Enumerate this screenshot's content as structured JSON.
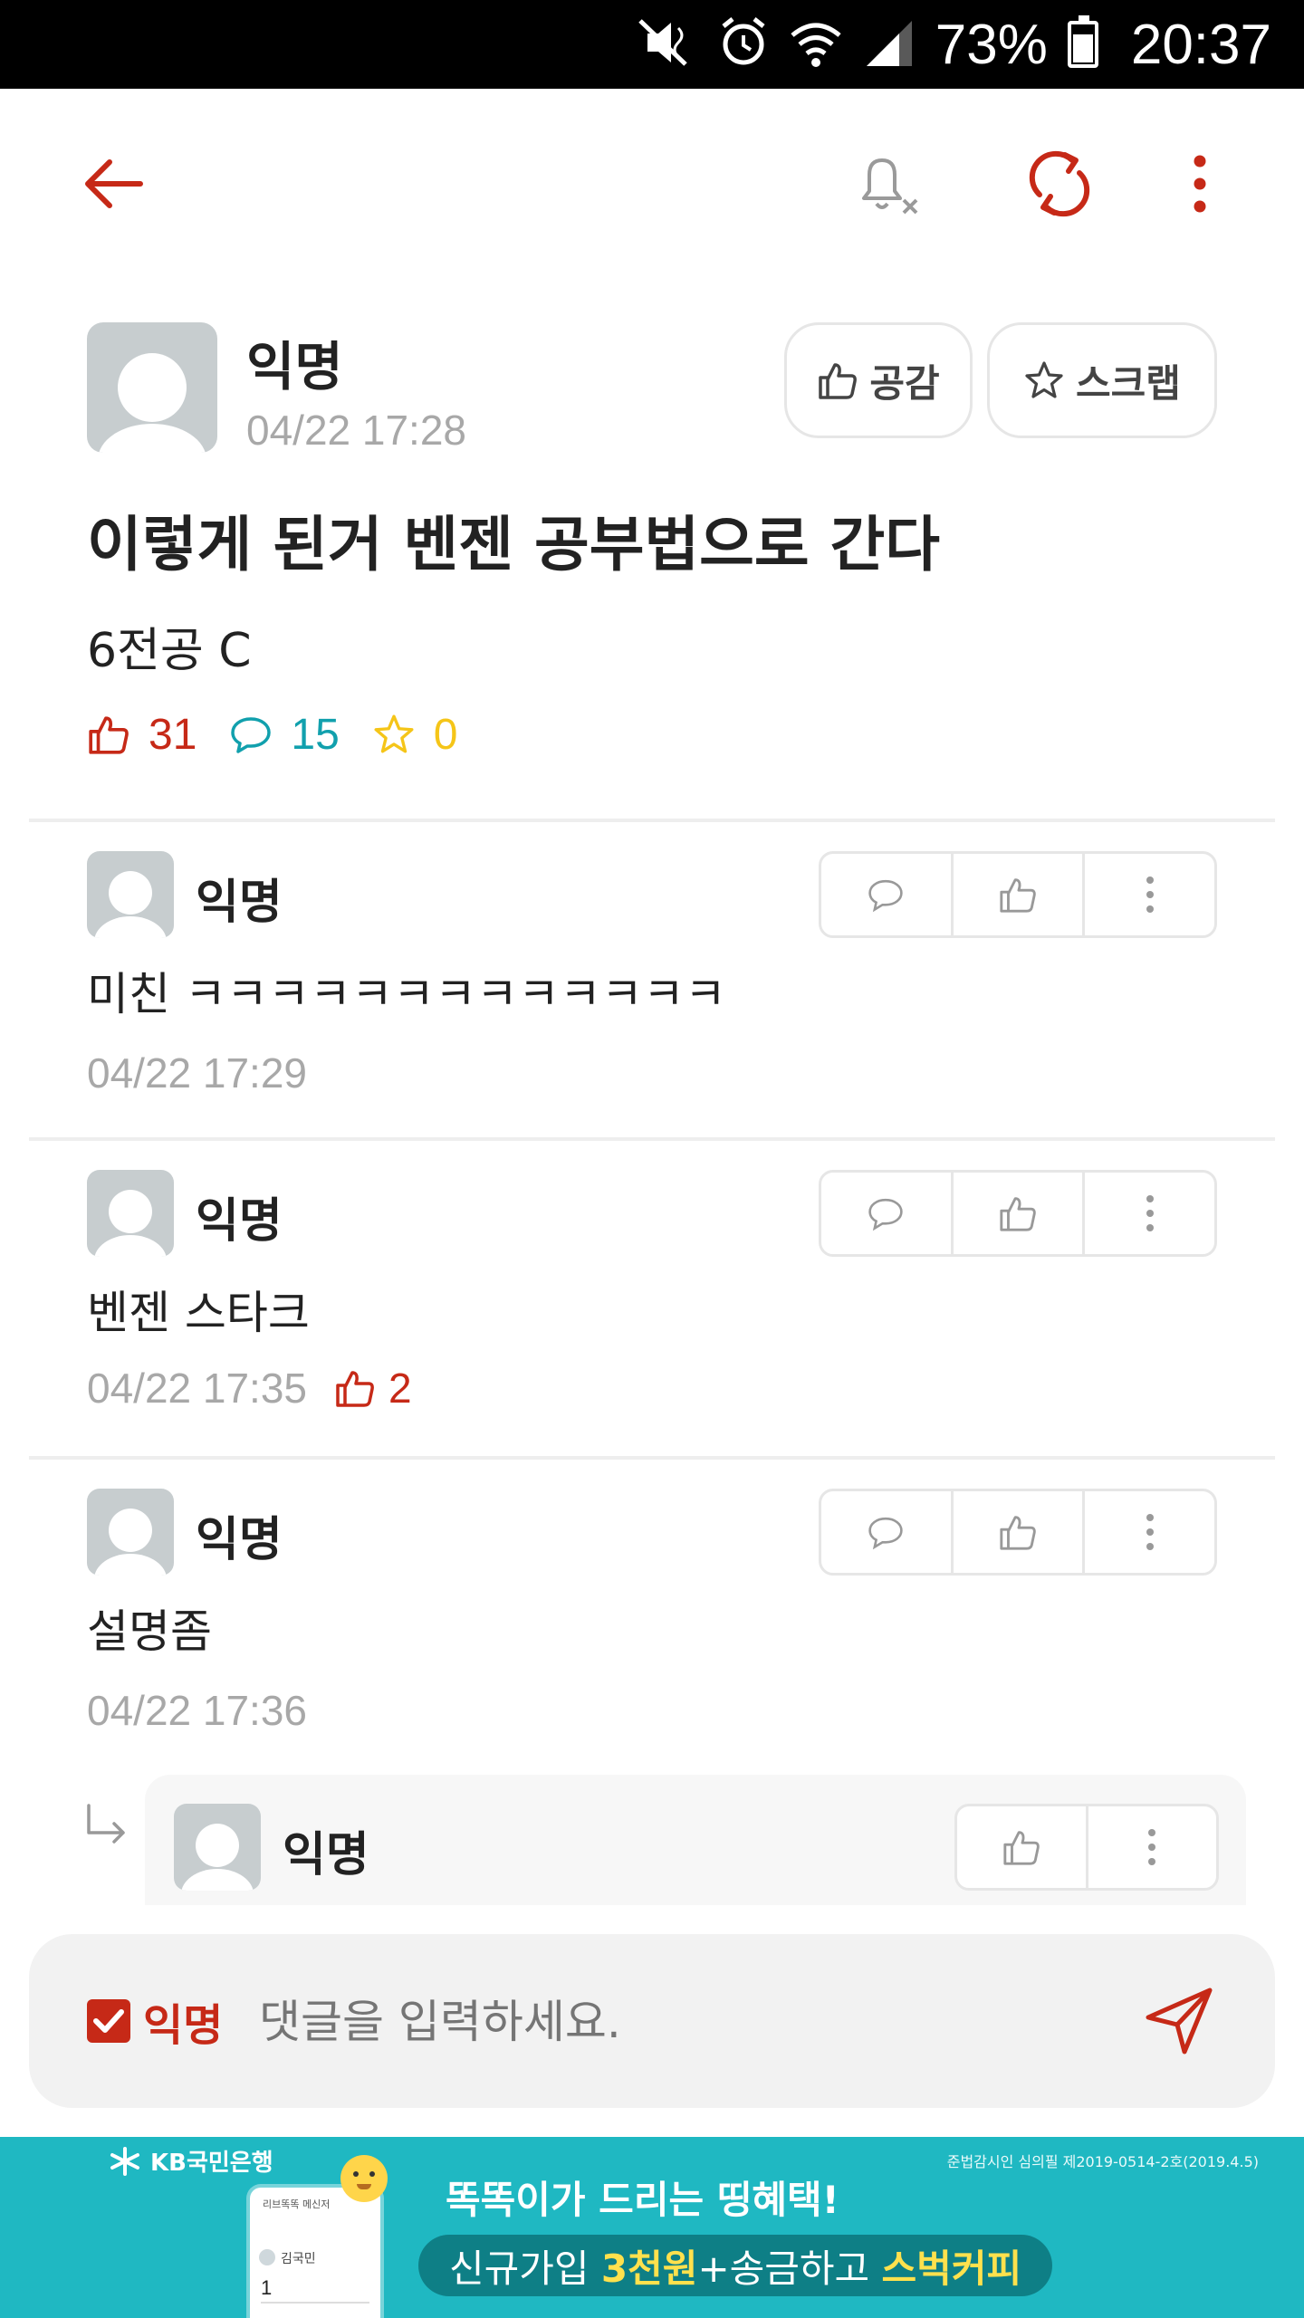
{
  "status_bar": {
    "battery": "73%",
    "time": "20:37",
    "icons": [
      "mute-icon",
      "alarm-icon",
      "wifi-icon",
      "signal-icon",
      "battery-icon"
    ]
  },
  "toolbar": {
    "icons": [
      "back-arrow-icon",
      "bell-off-icon",
      "refresh-icon",
      "more-vert-icon"
    ],
    "accent": "#c62917"
  },
  "post": {
    "author": "익명",
    "timestamp": "04/22 17:28",
    "like_button": "공감",
    "scrap_button": "스크랩",
    "title": "이렇게 된거 벤젠 공부법으로 간다",
    "body": "6전공 C",
    "stats": {
      "likes": "31",
      "comments": "15",
      "scraps": "0"
    },
    "colors": {
      "likes": "#c62917",
      "comments": "#11a0ad",
      "scraps": "#f5c518"
    }
  },
  "comments": [
    {
      "author": "익명",
      "text": "미친 ㅋㅋㅋㅋㅋㅋㅋㅋㅋㅋㅋㅋㅋ",
      "timestamp": "04/22 17:29",
      "likes": ""
    },
    {
      "author": "익명",
      "text": "벤젠 스타크",
      "timestamp": "04/22 17:35",
      "likes": "2"
    },
    {
      "author": "익명",
      "text": "설명좀",
      "timestamp": "04/22 17:36",
      "likes": ""
    }
  ],
  "reply": {
    "author": "익명"
  },
  "composer": {
    "anonymous_label": "익명",
    "anonymous_checked": true,
    "placeholder": "댓글을 입력하세요."
  },
  "ad": {
    "bank": "KB국민은행",
    "notice": "준법감시인 심의필 제2019-0514-2호(2019.4.5)",
    "headline": "똑똑이가 드리는 띵혜택!",
    "line_pre": "신규가입 ",
    "line_hl1": "3천원",
    "line_mid": "+송금하고 ",
    "line_hl2": "스벅커피",
    "card_title": "리브똑똑 메신저",
    "card_name": "김국민",
    "card_value": "1"
  }
}
